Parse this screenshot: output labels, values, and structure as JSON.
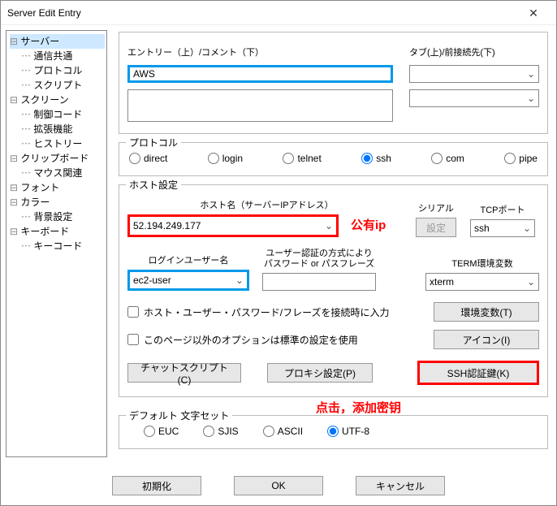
{
  "window": {
    "title": "Server Edit Entry"
  },
  "sidebar": {
    "items": [
      {
        "label": "サーバー",
        "top": true,
        "selected": true
      },
      {
        "label": "通信共通"
      },
      {
        "label": "プロトコル"
      },
      {
        "label": "スクリプト"
      },
      {
        "label": "スクリーン",
        "top": true
      },
      {
        "label": "制御コード"
      },
      {
        "label": "拡張機能"
      },
      {
        "label": "ヒストリー"
      },
      {
        "label": "クリップボード",
        "top": true
      },
      {
        "label": "マウス関連"
      },
      {
        "label": "フォント",
        "top": true
      },
      {
        "label": "カラー",
        "top": true
      },
      {
        "label": "背景設定"
      },
      {
        "label": "キーボード",
        "top": true
      },
      {
        "label": "キーコード"
      }
    ]
  },
  "entry": {
    "label_top": "エントリー（上）/コメント（下）",
    "value": "AWS",
    "comment": "",
    "tab_label": "タブ(上)/前接続先(下)",
    "tab_value": "",
    "prev_value": ""
  },
  "protocol": {
    "legend": "プロトコル",
    "options": [
      "direct",
      "login",
      "telnet",
      "ssh",
      "com",
      "pipe"
    ],
    "selected": "ssh"
  },
  "host": {
    "legend": "ホスト設定",
    "hostname_label": "ホスト名（サーバーIPアドレス）",
    "hostname": "52.194.249.177",
    "serial_label": "シリアル",
    "serial_btn": "設定",
    "tcpport_label": "TCPポート",
    "tcpport": "ssh",
    "login_label": "ログインユーザー名",
    "login": "ec2-user",
    "auth_label": "ユーザー認証の方式により\nパスワード or パスフレーズ",
    "auth_value": "",
    "term_label": "TERM環境変数",
    "term_value": "xterm",
    "cb_connect": "ホスト・ユーザー・パスワード/フレーズを接続時に入力",
    "cb_default": "このページ以外のオプションは標準の設定を使用",
    "btn_env": "環境変数(T)",
    "btn_icon": "アイコン(I)",
    "btn_chat": "チャットスクリプト(C)",
    "btn_proxy": "プロキシ設定(P)",
    "btn_sshkey": "SSH認証鍵(K)"
  },
  "charset": {
    "legend": "デフォルト 文字セット",
    "options": [
      "EUC",
      "SJIS",
      "ASCII",
      "UTF-8"
    ],
    "selected": "UTF-8"
  },
  "footer": {
    "init": "初期化",
    "ok": "OK",
    "cancel": "キャンセル"
  },
  "annot": {
    "public_ip": "公有ip",
    "click_add": "点击，添加密钥"
  }
}
